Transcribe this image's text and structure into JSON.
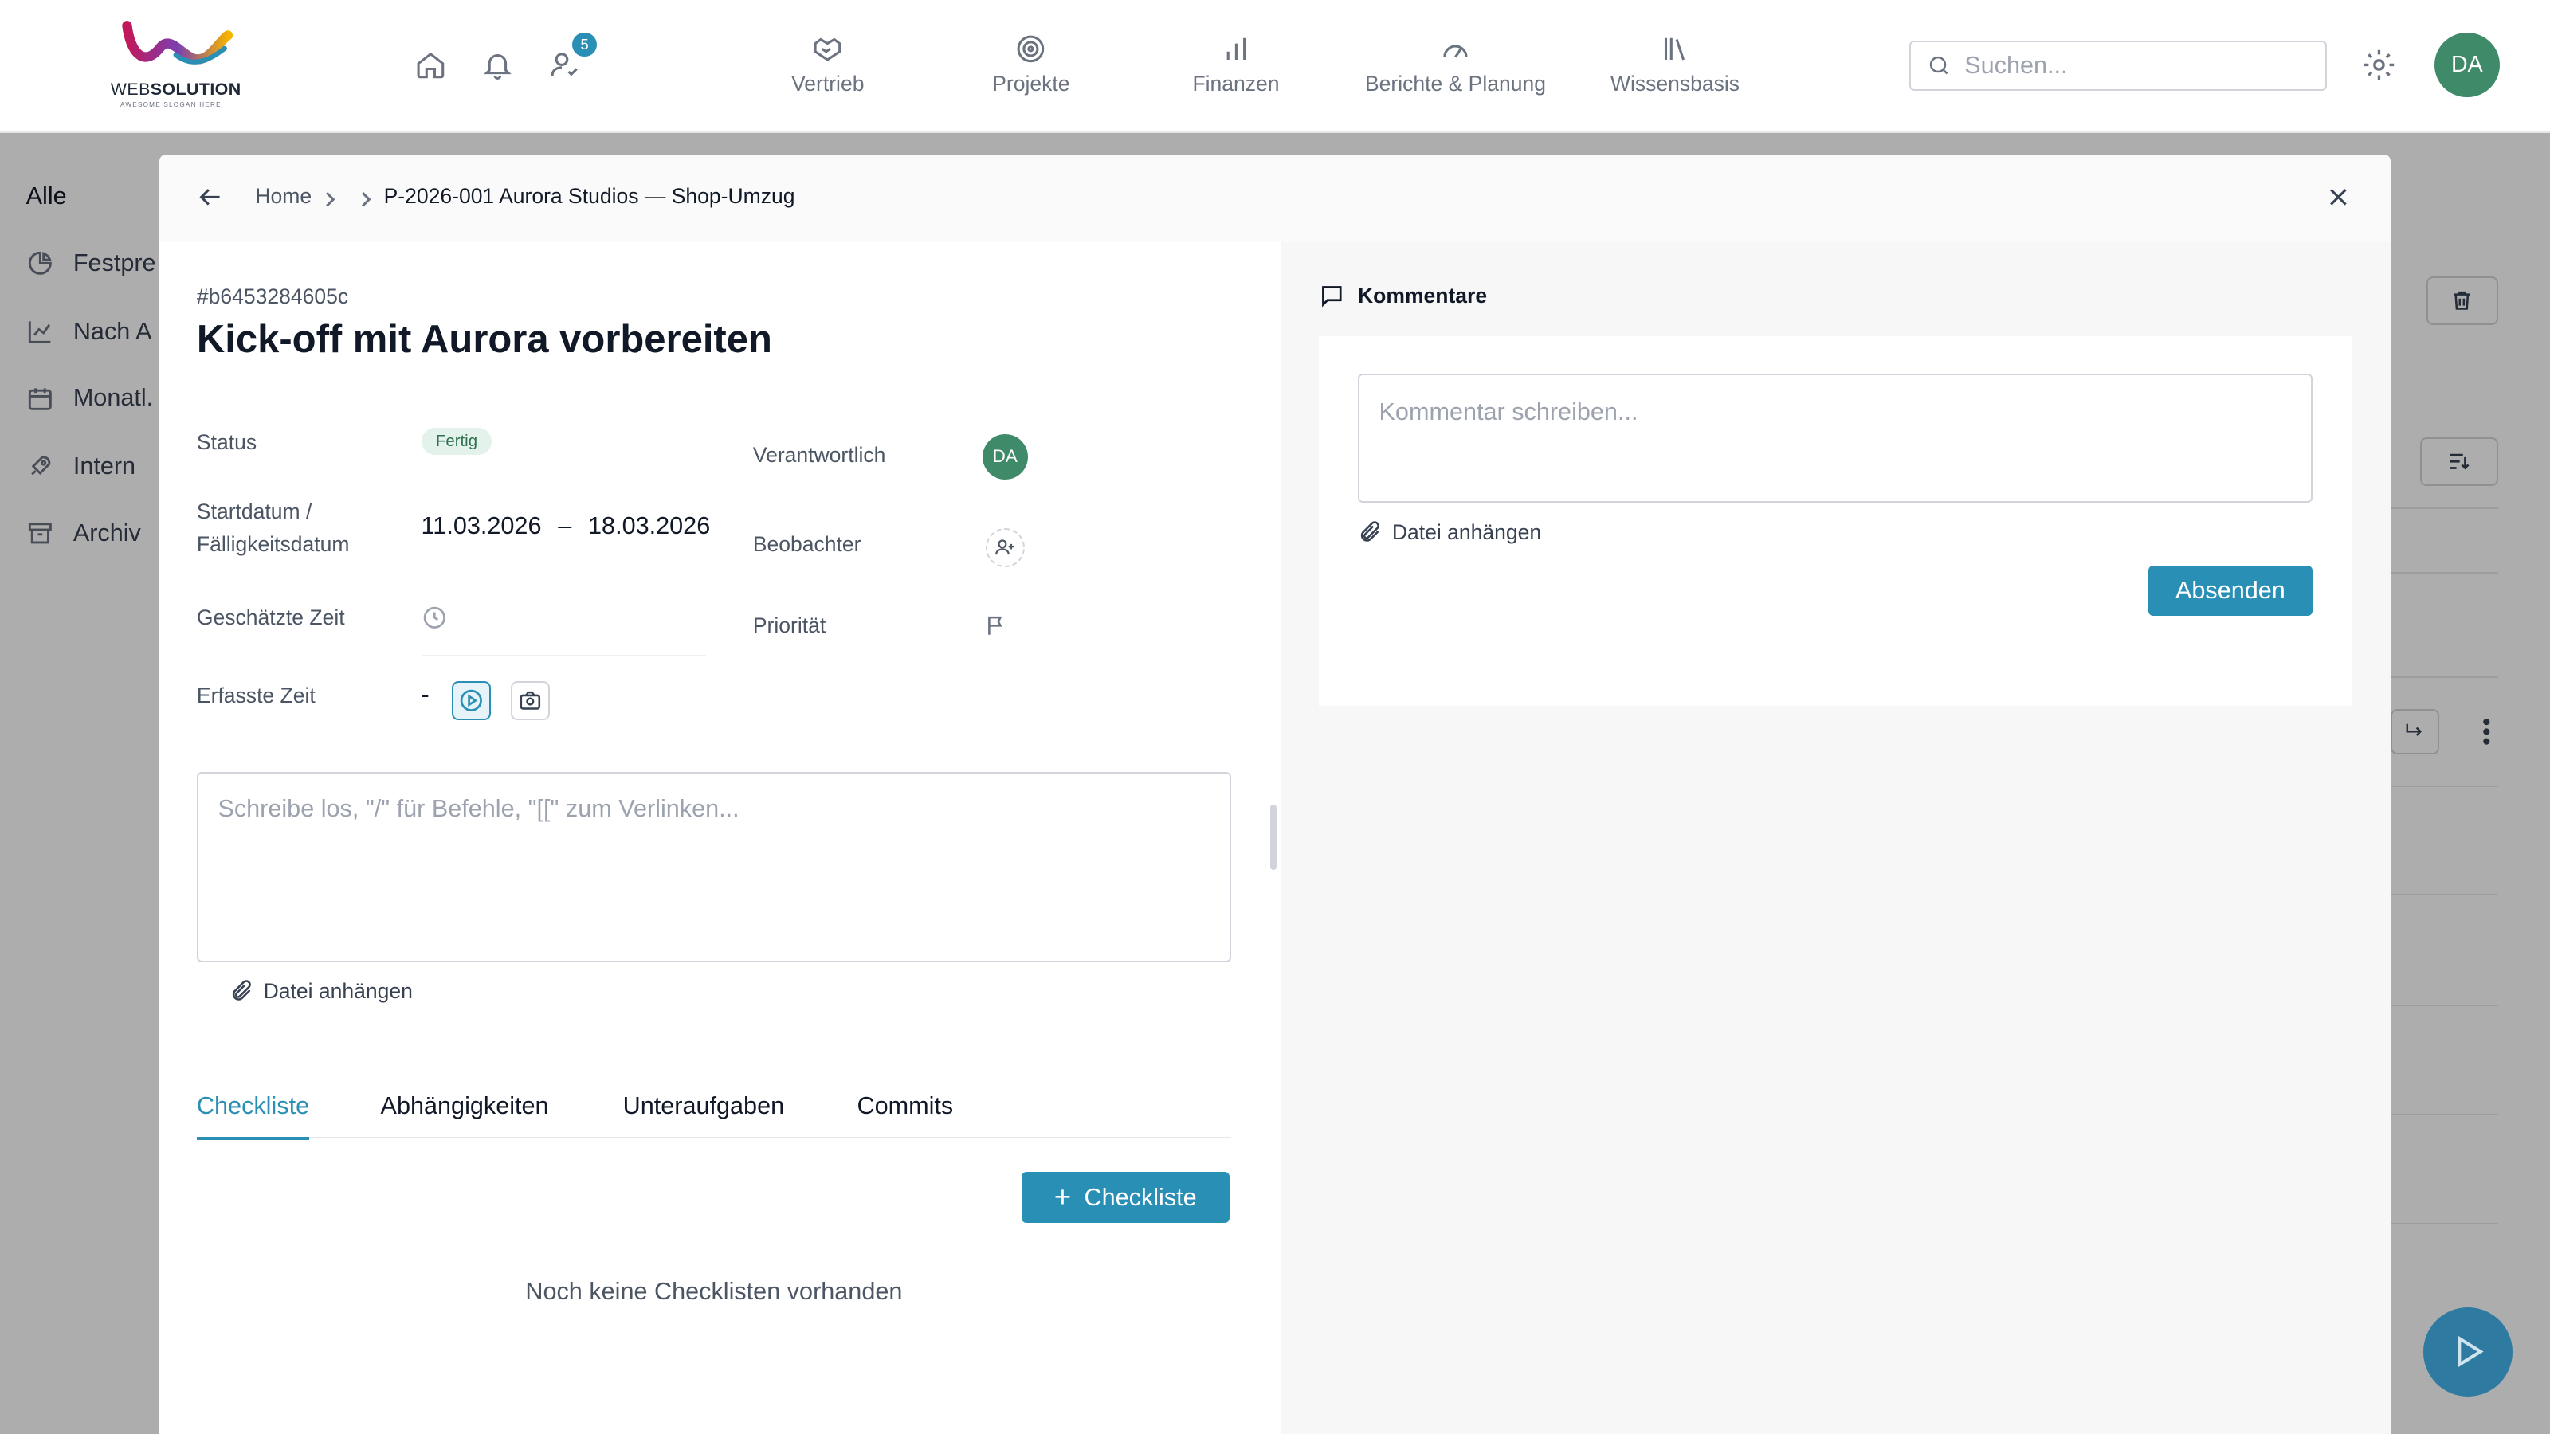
{
  "header": {
    "logo_name_bold_a": "WEB",
    "logo_name_bold_b": "SOLUTION",
    "logo_slogan": "AWESOME SLOGAN HERE",
    "notification_count": "5",
    "nav": [
      {
        "label": "Vertrieb",
        "icon": "handshake-icon"
      },
      {
        "label": "Projekte",
        "icon": "target-icon"
      },
      {
        "label": "Finanzen",
        "icon": "bar-chart-icon"
      },
      {
        "label": "Berichte & Planung",
        "icon": "gauge-icon"
      },
      {
        "label": "Wissensbasis",
        "icon": "books-icon"
      }
    ],
    "search_placeholder": "Suchen...",
    "user_initials": "DA"
  },
  "background": {
    "sidebar_title": "Alle",
    "sidebar_items": [
      {
        "label": "Festpre",
        "icon": "pie-chart-icon"
      },
      {
        "label": "Nach A",
        "icon": "line-chart-icon"
      },
      {
        "label": "Monatl.",
        "icon": "calendar-icon"
      },
      {
        "label": "Intern",
        "icon": "rocket-icon"
      },
      {
        "label": "Archiv",
        "icon": "archive-icon"
      }
    ]
  },
  "modal": {
    "breadcrumb": {
      "home": "Home",
      "project": "P-2026-001 Aurora Studios — Shop-Umzug"
    },
    "task": {
      "id": "#b6453284605c",
      "title": "Kick-off mit Aurora vorbereiten",
      "fields": {
        "status_label": "Status",
        "status_value": "Fertig",
        "dates_label": "Startdatum / Fälligkeitsdatum",
        "start_date": "11.03.2026",
        "date_separator": "–",
        "due_date": "18.03.2026",
        "estimated_label": "Geschätzte Zeit",
        "tracked_label": "Erfasste Zeit",
        "tracked_value": "-",
        "assignee_label": "Verantwortlich",
        "assignee_initials": "DA",
        "watchers_label": "Beobachter",
        "priority_label": "Priorität"
      },
      "editor_placeholder": "Schreibe los, \"/\" für Befehle, \"[[\" zum Verlinken...",
      "attach_label": "Datei anhängen",
      "tabs": [
        {
          "label": "Checkliste",
          "active": true
        },
        {
          "label": "Abhängigkeiten",
          "active": false
        },
        {
          "label": "Unteraufgaben",
          "active": false
        },
        {
          "label": "Commits",
          "active": false
        }
      ],
      "add_checklist_label": "Checkliste",
      "empty_checklists": "Noch keine Checklisten vorhanden"
    },
    "comments": {
      "title": "Kommentare",
      "input_placeholder": "Kommentar schreiben...",
      "attach_label": "Datei anhängen",
      "send_label": "Absenden"
    }
  },
  "colors": {
    "accent": "#2a8fb5",
    "avatar": "#3f8a68",
    "status_done_bg": "#e3f2ea"
  }
}
